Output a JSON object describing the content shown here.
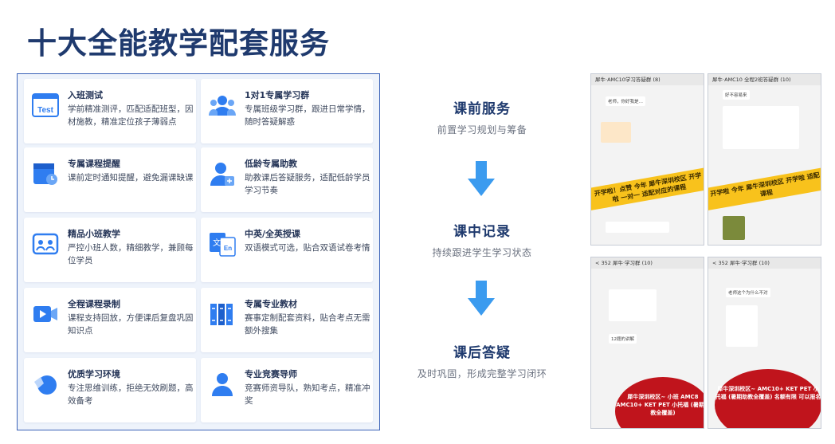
{
  "page_title": "十大全能教学配套服务",
  "services": [
    {
      "title": "入班测试",
      "desc": "学前精准测评，匹配适配班型，因材施教，精准定位孩子薄弱点",
      "icon": "test-icon",
      "icon_label": "Test"
    },
    {
      "title": "1对1专属学习群",
      "desc": "专属班级学习群，跟进日常学情，随时答疑解惑",
      "icon": "group-icon"
    },
    {
      "title": "专属课程提醒",
      "desc": "课前定时通知提醒，避免漏课缺课",
      "icon": "reminder-icon"
    },
    {
      "title": "低龄专属助教",
      "desc": "助教课后答疑服务，适配低龄学员学习节奏",
      "icon": "assistant-icon"
    },
    {
      "title": "精品小班教学",
      "desc": "严控小班人数，精细教学，兼顾每位学员",
      "icon": "small-class-icon"
    },
    {
      "title": "中英/全英授课",
      "desc": "双语模式可选，贴合双语试卷考情",
      "icon": "bilingual-icon",
      "icon_label_left": "文",
      "icon_label_right": "En"
    },
    {
      "title": "全程课程录制",
      "desc": "课程支持回放，方便课后复盘巩固知识点",
      "icon": "video-icon"
    },
    {
      "title": "专属专业教材",
      "desc": "赛事定制配套资料，贴合考点无需额外搜集",
      "icon": "books-icon"
    },
    {
      "title": "优质学习环境",
      "desc": "专注思维训练，拒绝无效刷题，高效备考",
      "icon": "environment-icon"
    },
    {
      "title": "专业竞赛导师",
      "desc": "竞赛师资导队，熟知考点，精准冲奖",
      "icon": "mentor-icon"
    }
  ],
  "steps": [
    {
      "title": "课前服务",
      "desc": "前置学习规划与筹备"
    },
    {
      "title": "课中记录",
      "desc": "持续跟进学生学习状态"
    },
    {
      "title": "课后答疑",
      "desc": "及时巩固，形成完整学习闭环"
    }
  ],
  "screenshots": [
    {
      "title": "犀牛·AMC10学习答疑群 (8)",
      "greeting": "老师，你好我是…",
      "banner": "开学啦！点赞 今年 犀牛深圳校区 开学啦 一对一 适配对应的课程"
    },
    {
      "title": "犀牛·AMC10 全程2班答疑群 (10)",
      "greeting": "好不容易来",
      "banner": "开学啦 今年 犀牛深圳校区 开学啦 适配课程"
    },
    {
      "title": "< 352 犀牛·学习群 (10)",
      "greeting": "12题的讲解",
      "ad": "犀牛深圳校区~ 小班 AMC8 AMC10+ KET PET 小托福 (暑期助教全覆盖)"
    },
    {
      "title": "< 352 犀牛·学习群 (10)",
      "greeting": "老师这个为什么不对",
      "ad": "犀牛深圳校区~ AMC10+ KET PET 小托福 (暑期助教全覆盖) 名额有限 可以报名"
    }
  ],
  "colors": {
    "title": "#1f3a6e",
    "panel_border": "#3b63b8",
    "panel_bg": "#eef3fb",
    "icon_blue": "#2f7df0",
    "arrow": "#3b9bef"
  }
}
